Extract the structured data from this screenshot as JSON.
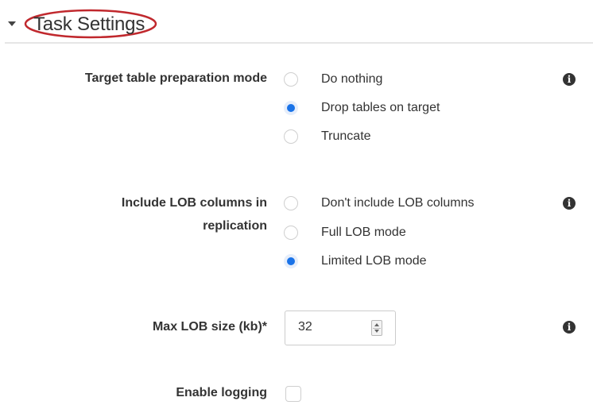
{
  "header": {
    "title": "Task Settings"
  },
  "target_table_prep": {
    "label": "Target table preparation mode",
    "options": [
      {
        "label": "Do nothing",
        "checked": false
      },
      {
        "label": "Drop tables on target",
        "checked": true
      },
      {
        "label": "Truncate",
        "checked": false
      }
    ]
  },
  "lob_columns": {
    "label_line1": "Include LOB columns in",
    "label_line2": "replication",
    "options": [
      {
        "label": "Don't include LOB columns",
        "checked": false
      },
      {
        "label": "Full LOB mode",
        "checked": false
      },
      {
        "label": "Limited LOB mode",
        "checked": true
      }
    ]
  },
  "max_lob": {
    "label": "Max LOB size (kb)*",
    "value": "32"
  },
  "logging": {
    "label": "Enable logging",
    "checked": false
  },
  "icons": {
    "info_glyph": "i",
    "accent_color": "#1a73e8",
    "annotation_color": "#c0282d"
  }
}
